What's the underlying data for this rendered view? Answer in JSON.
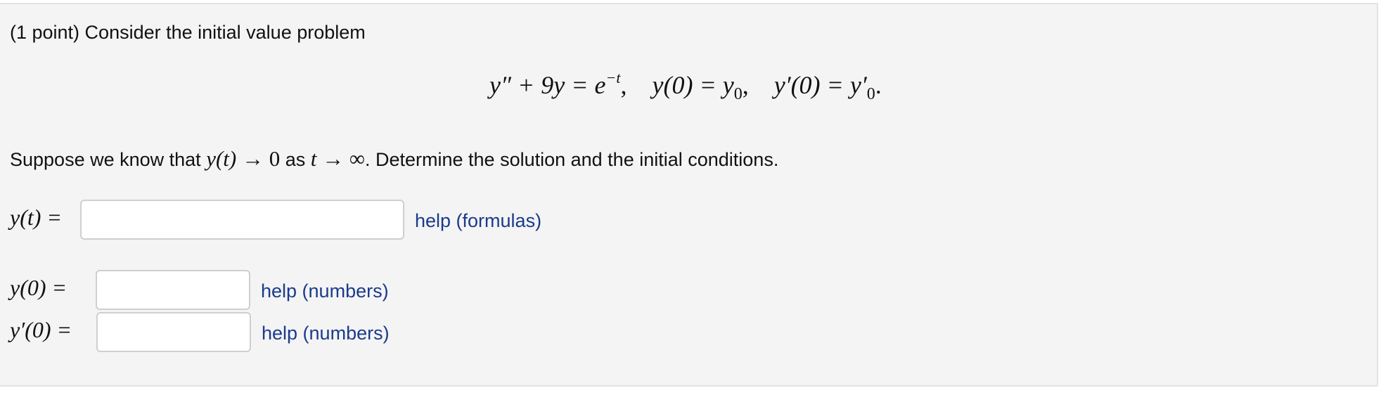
{
  "problem": {
    "intro": "(1 point) Consider the initial value problem",
    "equation": {
      "ode_lhs": "y″ + 9y = e",
      "exponent": "−t",
      "sep1": ",",
      "ic1_lhs": "y(0) = y",
      "ic1_sub": "0",
      "sep2": ",",
      "ic2_lhs": "y′(0) = y′",
      "ic2_sub": "0",
      "end": "."
    },
    "question": {
      "part1": "Suppose we know that ",
      "yt": "y(t)",
      "arrow1": " → 0",
      "part2": " as ",
      "t": "t",
      "arrow2": " → ∞",
      "part3": ". Determine the solution and the initial conditions."
    }
  },
  "answers": {
    "solution": {
      "label": "y(t) =",
      "value": "",
      "help": "help (formulas)"
    },
    "y0": {
      "label": "y(0) =",
      "value": "",
      "help": "help (numbers)"
    },
    "yp0": {
      "label": "y′(0) =",
      "value": "",
      "help": "help (numbers)"
    }
  }
}
